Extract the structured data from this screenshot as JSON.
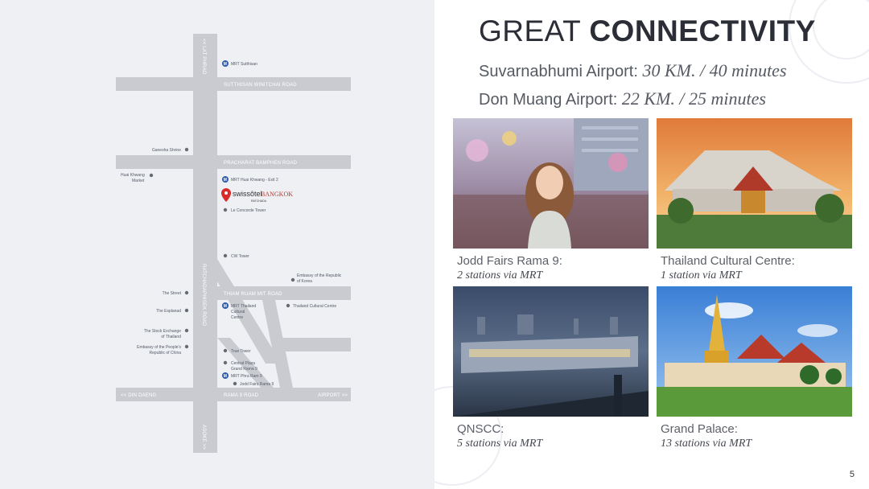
{
  "map": {
    "roads": {
      "lat_phrao": "<< LAT PHRAO",
      "sutthisan": "SUTTHISAN WINITCHAI ROAD",
      "pracharat": "PRACHARAT BAMPHEN ROAD",
      "thiam_ruam_mit": "THIAM RUAM MIT ROAD",
      "ratchadaphisek": "RATCHADAPHISEK ROAD",
      "din_daeng": "<< DIN DAENG",
      "rama9": "RAMA 9 ROAD",
      "airport": "AIRPORT >>",
      "asoke": "ASOKE >>"
    },
    "pois": {
      "mrt_sutthisan": "MRT Sutthisan",
      "ganesha": "Ganesha Shrine",
      "huai_khwang_market_1": "Huai Khwang",
      "huai_khwang_market_2": "Market",
      "mrt_huai_khwang": "MRT Huai Khwang - Exit 2",
      "le_concorde": "Le Concorde Tower",
      "cw_tower": "CW Tower",
      "korea_1": "Embassy of the Republic",
      "korea_2": "of Korea",
      "the_street": "The Street",
      "esplanade": "The Esplanad",
      "mrt_tcc_1": "MRT Thailand",
      "mrt_tcc_2": "Cultural",
      "mrt_tcc_3": "Centre",
      "tcc": "Thailand Cultural Centre",
      "set_1": "The Stock Exchange",
      "set_2": "of Thailand",
      "china_1": "Embassy of the People's",
      "china_2": "Republic of China",
      "true_tower": "True Tower",
      "central_1": "Central Plaza",
      "central_2": "Grand Rama 9",
      "mrt_rama9": "MRT Phra Ram 9",
      "jodd_fairs": "Jodd Fairs Rama 9"
    },
    "hotel": {
      "brand": "swissôtel",
      "city": "BANGKOK",
      "sub": "RATCHADA"
    },
    "mrt_letter": "M"
  },
  "title": {
    "light": "GREAT",
    "bold": "CONNECTIVITY"
  },
  "airports": [
    {
      "label": "Suvarnabhumi Airport:",
      "value": "30 KM. / 40 minutes"
    },
    {
      "label": "Don Muang Airport:",
      "value": "22 KM. / 25 minutes"
    }
  ],
  "attractions": [
    {
      "name": "Jodd Fairs Rama 9:",
      "detail": "2 stations via MRT"
    },
    {
      "name": "Thailand Cultural Centre:",
      "detail": "1 station via MRT"
    },
    {
      "name": "QNSCC:",
      "detail": "5 stations via MRT"
    },
    {
      "name": "Grand Palace:",
      "detail": "13 stations via MRT"
    }
  ],
  "page_number": "5",
  "colors": {
    "map_background": "#eef0f4",
    "road": "#c9cbd1",
    "poi_dot": "#666a73",
    "mrt_icon": "#2f5aa8",
    "hotel_pin": "#d92b2b",
    "hotel_city": "#c0392b",
    "title": "#2b2e36"
  }
}
